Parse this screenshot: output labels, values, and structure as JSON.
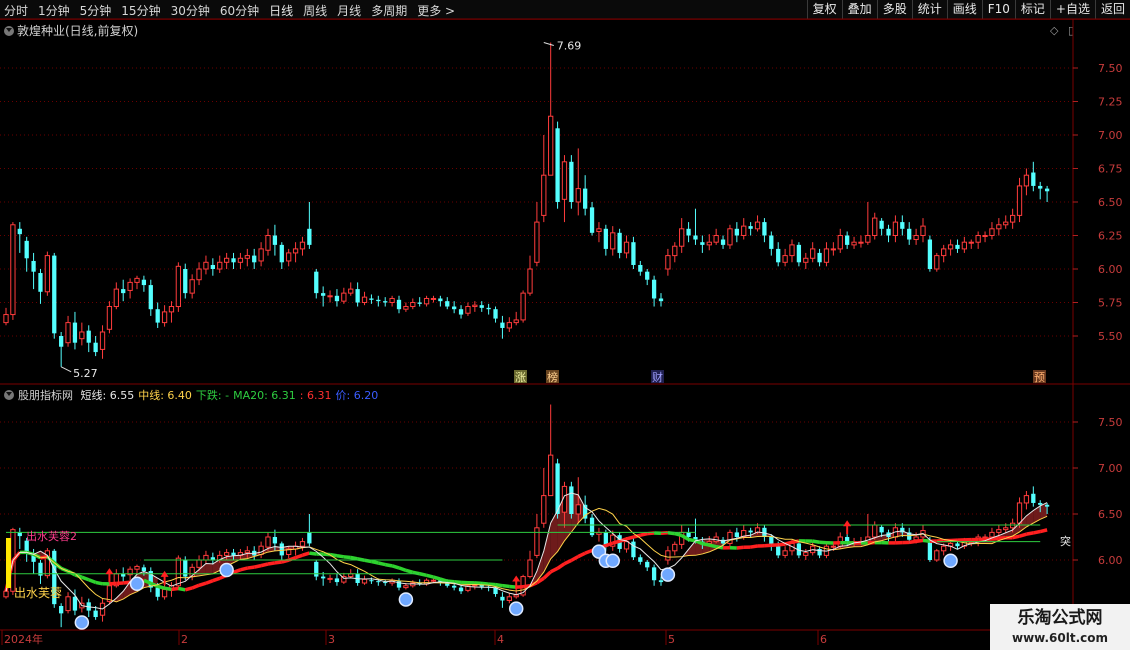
{
  "toolbar": {
    "periods": [
      "分时",
      "1分钟",
      "5分钟",
      "15分钟",
      "30分钟",
      "60分钟",
      "日线",
      "周线",
      "月线",
      "多周期",
      "更多"
    ],
    "active": "日线",
    "actions": [
      "复权",
      "叠加",
      "多股",
      "统计",
      "画线",
      "F10",
      "标记",
      "+自选",
      "返回"
    ]
  },
  "main_chart": {
    "title": "敦煌种业(日线,前复权)",
    "y_ticks": [
      "7.50",
      "7.25",
      "7.00",
      "6.75",
      "6.50",
      "6.25",
      "6.00",
      "5.75",
      "5.50"
    ],
    "y_values": [
      7.5,
      7.25,
      7.0,
      6.75,
      6.5,
      6.25,
      6.0,
      5.75,
      5.5
    ],
    "max_label": "7.69",
    "min_label": "5.27",
    "event_tags": [
      "涨",
      "榜",
      "财",
      "预"
    ]
  },
  "sub_chart": {
    "name": "股朋指标网",
    "fields": [
      {
        "label": "短线:",
        "value": "6.55",
        "color": "#e8e8e8"
      },
      {
        "label": "中线:",
        "value": "6.40",
        "color": "#ffd24a"
      },
      {
        "label": "下跌:",
        "value": "-",
        "color": "#2ecc40"
      },
      {
        "label": "MA20:",
        "value": "6.31",
        "color": "#2ecc40"
      },
      {
        "label": ":",
        "value": "6.31",
        "color": "#ff3030"
      },
      {
        "label": "价:",
        "value": "6.20",
        "color": "#3a5cff"
      }
    ],
    "y_ticks": [
      "7.50",
      "7.00",
      "6.50",
      "6.00"
    ],
    "y_values": [
      7.5,
      7.0,
      6.5,
      6.0
    ],
    "labels": [
      "出水芙蓉2",
      "出水芙蓉",
      "突"
    ]
  },
  "x_axis": {
    "labels": [
      "2024年",
      "2",
      "3",
      "4",
      "5",
      "6"
    ]
  },
  "watermark": {
    "title": "乐淘公式网",
    "url": "www.60lt.com"
  },
  "chart_data": {
    "type": "candlestick",
    "candles": [
      [
        5.6,
        5.66,
        5.71,
        5.58
      ],
      [
        5.66,
        6.33,
        6.35,
        5.62
      ],
      [
        6.3,
        6.26,
        6.35,
        6.12
      ],
      [
        6.21,
        6.08,
        6.24,
        5.98
      ],
      [
        6.06,
        5.98,
        6.12,
        5.85
      ],
      [
        5.97,
        5.83,
        6.0,
        5.74
      ],
      [
        5.83,
        6.1,
        6.13,
        5.8
      ],
      [
        6.1,
        5.52,
        6.12,
        5.48
      ],
      [
        5.5,
        5.42,
        5.53,
        5.27
      ],
      [
        5.45,
        5.6,
        5.65,
        5.42
      ],
      [
        5.6,
        5.45,
        5.68,
        5.4
      ],
      [
        5.48,
        5.53,
        5.6,
        5.43
      ],
      [
        5.54,
        5.45,
        5.58,
        5.38
      ],
      [
        5.45,
        5.38,
        5.5,
        5.35
      ],
      [
        5.4,
        5.53,
        5.58,
        5.33
      ],
      [
        5.55,
        5.72,
        5.76,
        5.52
      ],
      [
        5.72,
        5.85,
        5.9,
        5.7
      ],
      [
        5.85,
        5.82,
        5.92,
        5.76
      ],
      [
        5.84,
        5.9,
        5.93,
        5.78
      ],
      [
        5.9,
        5.93,
        5.95,
        5.85
      ],
      [
        5.92,
        5.88,
        5.95,
        5.83
      ],
      [
        5.88,
        5.7,
        5.92,
        5.65
      ],
      [
        5.7,
        5.6,
        5.75,
        5.56
      ],
      [
        5.6,
        5.68,
        5.73,
        5.57
      ],
      [
        5.68,
        5.72,
        5.76,
        5.6
      ],
      [
        5.72,
        6.02,
        6.05,
        5.68
      ],
      [
        6.0,
        5.82,
        6.04,
        5.78
      ],
      [
        5.82,
        5.92,
        5.96,
        5.78
      ],
      [
        5.92,
        6.0,
        6.05,
        5.88
      ],
      [
        6.0,
        6.05,
        6.1,
        5.96
      ],
      [
        6.03,
        6.0,
        6.08,
        5.95
      ],
      [
        6.0,
        6.05,
        6.1,
        5.97
      ],
      [
        6.05,
        6.08,
        6.12,
        6.0
      ],
      [
        6.08,
        6.05,
        6.12,
        6.0
      ],
      [
        6.05,
        6.08,
        6.12,
        6.0
      ],
      [
        6.08,
        6.1,
        6.15,
        6.02
      ],
      [
        6.1,
        6.05,
        6.15,
        6.0
      ],
      [
        6.06,
        6.15,
        6.2,
        6.02
      ],
      [
        6.14,
        6.25,
        6.3,
        6.1
      ],
      [
        6.25,
        6.18,
        6.33,
        6.1
      ],
      [
        6.18,
        6.05,
        6.2,
        6.0
      ],
      [
        6.06,
        6.12,
        6.15,
        6.02
      ],
      [
        6.12,
        6.15,
        6.2,
        6.05
      ],
      [
        6.15,
        6.2,
        6.24,
        6.1
      ],
      [
        6.3,
        6.18,
        6.5,
        6.15
      ],
      [
        5.98,
        5.82,
        6.0,
        5.78
      ],
      [
        5.82,
        5.8,
        5.87,
        5.72
      ],
      [
        5.8,
        5.8,
        5.84,
        5.75
      ],
      [
        5.8,
        5.76,
        5.85,
        5.72
      ],
      [
        5.76,
        5.82,
        5.86,
        5.74
      ],
      [
        5.82,
        5.85,
        5.9,
        5.8
      ],
      [
        5.85,
        5.75,
        5.9,
        5.72
      ],
      [
        5.75,
        5.79,
        5.83,
        5.73
      ],
      [
        5.78,
        5.77,
        5.81,
        5.74
      ],
      [
        5.77,
        5.76,
        5.8,
        5.72
      ],
      [
        5.76,
        5.75,
        5.79,
        5.72
      ],
      [
        5.75,
        5.78,
        5.8,
        5.72
      ],
      [
        5.77,
        5.7,
        5.8,
        5.67
      ],
      [
        5.7,
        5.72,
        5.75,
        5.68
      ],
      [
        5.72,
        5.75,
        5.78,
        5.7
      ],
      [
        5.75,
        5.74,
        5.79,
        5.72
      ],
      [
        5.74,
        5.78,
        5.8,
        5.72
      ],
      [
        5.78,
        5.78,
        5.8,
        5.75
      ],
      [
        5.78,
        5.76,
        5.8,
        5.72
      ],
      [
        5.76,
        5.72,
        5.79,
        5.7
      ],
      [
        5.72,
        5.7,
        5.76,
        5.67
      ],
      [
        5.7,
        5.66,
        5.73,
        5.63
      ],
      [
        5.67,
        5.72,
        5.75,
        5.65
      ],
      [
        5.72,
        5.73,
        5.76,
        5.68
      ],
      [
        5.73,
        5.71,
        5.76,
        5.68
      ],
      [
        5.71,
        5.7,
        5.74,
        5.66
      ],
      [
        5.7,
        5.63,
        5.72,
        5.6
      ],
      [
        5.6,
        5.56,
        5.65,
        5.48
      ],
      [
        5.56,
        5.6,
        5.64,
        5.53
      ],
      [
        5.6,
        5.62,
        5.68,
        5.58
      ],
      [
        5.62,
        5.82,
        5.84,
        5.6
      ],
      [
        5.82,
        6.0,
        6.1,
        5.8
      ],
      [
        6.05,
        6.35,
        6.5,
        6.02
      ],
      [
        6.4,
        6.7,
        7.0,
        6.35
      ],
      [
        6.7,
        7.14,
        7.69,
        6.8
      ],
      [
        7.05,
        6.5,
        7.1,
        6.45
      ],
      [
        6.52,
        6.8,
        6.85,
        6.35
      ],
      [
        6.8,
        6.5,
        6.85,
        6.45
      ],
      [
        6.5,
        6.6,
        6.9,
        6.4
      ],
      [
        6.6,
        6.45,
        6.7,
        6.4
      ],
      [
        6.46,
        6.27,
        6.5,
        6.25
      ],
      [
        6.28,
        6.3,
        6.35,
        6.2
      ],
      [
        6.3,
        6.15,
        6.33,
        6.1
      ],
      [
        6.15,
        6.27,
        6.32,
        6.1
      ],
      [
        6.27,
        6.12,
        6.3,
        6.08
      ],
      [
        6.12,
        6.2,
        6.25,
        6.08
      ],
      [
        6.2,
        6.03,
        6.24,
        6.0
      ],
      [
        6.03,
        5.98,
        6.06,
        5.95
      ],
      [
        5.98,
        5.92,
        6.0,
        5.88
      ],
      [
        5.92,
        5.78,
        5.95,
        5.72
      ],
      [
        5.78,
        5.76,
        5.82,
        5.72
      ],
      [
        6.0,
        6.1,
        6.15,
        5.95
      ],
      [
        6.1,
        6.17,
        6.2,
        6.05
      ],
      [
        6.17,
        6.3,
        6.38,
        6.12
      ],
      [
        6.3,
        6.25,
        6.35,
        6.2
      ],
      [
        6.25,
        6.22,
        6.45,
        6.18
      ],
      [
        6.2,
        6.18,
        6.25,
        6.12
      ],
      [
        6.18,
        6.2,
        6.26,
        6.14
      ],
      [
        6.2,
        6.25,
        6.3,
        6.18
      ],
      [
        6.22,
        6.18,
        6.25,
        6.15
      ],
      [
        6.18,
        6.3,
        6.33,
        6.15
      ],
      [
        6.3,
        6.25,
        6.35,
        6.2
      ],
      [
        6.25,
        6.32,
        6.38,
        6.22
      ],
      [
        6.32,
        6.3,
        6.35,
        6.25
      ],
      [
        6.3,
        6.35,
        6.4,
        6.28
      ],
      [
        6.35,
        6.25,
        6.38,
        6.2
      ],
      [
        6.25,
        6.15,
        6.28,
        6.1
      ],
      [
        6.15,
        6.05,
        6.2,
        6.02
      ],
      [
        6.05,
        6.1,
        6.15,
        6.02
      ],
      [
        6.1,
        6.18,
        6.22,
        6.05
      ],
      [
        6.18,
        6.05,
        6.2,
        6.02
      ],
      [
        6.05,
        6.08,
        6.12,
        6.0
      ],
      [
        6.08,
        6.15,
        6.2,
        6.05
      ],
      [
        6.12,
        6.05,
        6.15,
        6.02
      ],
      [
        6.05,
        6.15,
        6.2,
        6.02
      ],
      [
        6.15,
        6.15,
        6.2,
        6.1
      ],
      [
        6.15,
        6.25,
        6.3,
        6.12
      ],
      [
        6.25,
        6.18,
        6.28,
        6.15
      ],
      [
        6.18,
        6.2,
        6.24,
        6.15
      ],
      [
        6.2,
        6.2,
        6.25,
        6.16
      ],
      [
        6.2,
        6.25,
        6.5,
        6.18
      ],
      [
        6.25,
        6.38,
        6.42,
        6.22
      ],
      [
        6.36,
        6.3,
        6.38,
        6.25
      ],
      [
        6.3,
        6.25,
        6.33,
        6.2
      ],
      [
        6.25,
        6.35,
        6.4,
        6.2
      ],
      [
        6.35,
        6.3,
        6.4,
        6.25
      ],
      [
        6.3,
        6.22,
        6.35,
        6.18
      ],
      [
        6.22,
        6.25,
        6.3,
        6.18
      ],
      [
        6.25,
        6.32,
        6.38,
        6.2
      ],
      [
        6.22,
        6.0,
        6.25,
        5.98
      ],
      [
        6.0,
        6.1,
        6.12,
        5.98
      ],
      [
        6.1,
        6.15,
        6.18,
        6.05
      ],
      [
        6.15,
        6.18,
        6.22,
        6.1
      ],
      [
        6.18,
        6.15,
        6.22,
        6.12
      ],
      [
        6.15,
        6.2,
        6.24,
        6.12
      ],
      [
        6.2,
        6.2,
        6.22,
        6.15
      ],
      [
        6.2,
        6.25,
        6.28,
        6.15
      ],
      [
        6.25,
        6.25,
        6.28,
        6.2
      ],
      [
        6.25,
        6.3,
        6.35,
        6.22
      ],
      [
        6.3,
        6.33,
        6.38,
        6.25
      ],
      [
        6.33,
        6.35,
        6.4,
        6.3
      ],
      [
        6.35,
        6.4,
        6.45,
        6.3
      ],
      [
        6.4,
        6.62,
        6.68,
        6.35
      ],
      [
        6.62,
        6.7,
        6.75,
        6.55
      ],
      [
        6.72,
        6.62,
        6.8,
        6.58
      ],
      [
        6.62,
        6.6,
        6.65,
        6.52
      ],
      [
        6.6,
        6.58,
        6.62,
        6.5
      ]
    ]
  }
}
